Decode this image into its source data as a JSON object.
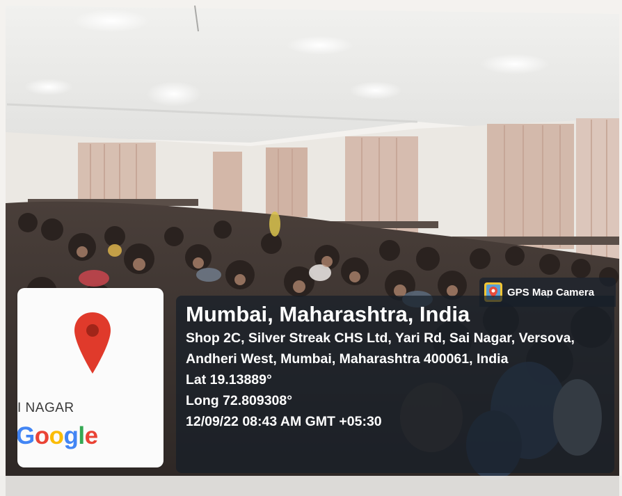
{
  "photo": {
    "scene": "lecture-hall-crowd",
    "colors": {
      "ceiling": "#e6e7e6",
      "wall": "#ece9e4",
      "curtain": "#d3b9ab",
      "crowd": "#3b3330"
    }
  },
  "map_card": {
    "pin_icon": "map-pin-icon",
    "pin_color": "#e03a2b",
    "area_label": "I NAGAR",
    "logo": {
      "letters": [
        "G",
        "o",
        "o",
        "g",
        "l",
        "e"
      ],
      "colors": [
        "#4285f4",
        "#ea4335",
        "#fbbc05",
        "#4285f4",
        "#34a853",
        "#ea4335"
      ]
    }
  },
  "gps_badge": {
    "icon": "gps-map-camera-icon",
    "label": "GPS Map Camera"
  },
  "info": {
    "title": "Mumbai, Maharashtra, India",
    "address_line_1": "Shop 2C, Silver Streak CHS Ltd, Yari Rd, Sai Nagar, Versova,",
    "address_line_2": "Andheri West, Mumbai, Maharashtra 400061, India",
    "lat": "Lat 19.13889°",
    "long": "Long 72.809308°",
    "datetime": "12/09/22 08:43 AM GMT +05:30"
  }
}
